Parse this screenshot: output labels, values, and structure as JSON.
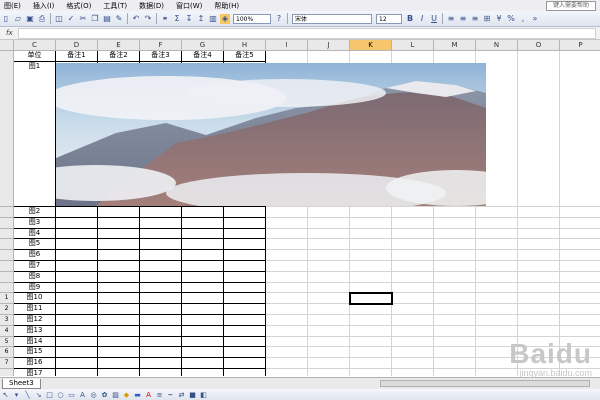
{
  "menubar": {
    "items": [
      "图(E)",
      "插入(I)",
      "格式(O)",
      "工具(T)",
      "数据(D)",
      "窗口(W)",
      "帮助(H)"
    ],
    "help_box": "键入需要帮助"
  },
  "toolbar": {
    "zoom": "100%",
    "font_name": "宋体",
    "font_size": "12"
  },
  "formula_bar": {
    "fx": "fx",
    "value": ""
  },
  "columns": [
    {
      "label": "C",
      "selected": false
    },
    {
      "label": "D",
      "selected": false
    },
    {
      "label": "E",
      "selected": false
    },
    {
      "label": "F",
      "selected": false
    },
    {
      "label": "G",
      "selected": false
    },
    {
      "label": "H",
      "selected": false
    },
    {
      "label": "I",
      "selected": false
    },
    {
      "label": "J",
      "selected": false
    },
    {
      "label": "K",
      "selected": true
    },
    {
      "label": "L",
      "selected": false
    },
    {
      "label": "M",
      "selected": false
    },
    {
      "label": "N",
      "selected": false
    },
    {
      "label": "O",
      "selected": false
    },
    {
      "label": "P",
      "selected": false
    }
  ],
  "header_row": [
    "单位",
    "备注1",
    "备注2",
    "备注3",
    "备注4",
    "备注5"
  ],
  "first_unit": "图1",
  "units": [
    "图2",
    "图3",
    "图4",
    "图5",
    "图6",
    "图7",
    "图8",
    "图9",
    "图10",
    "图11",
    "图12",
    "图13",
    "图14",
    "图15",
    "图16",
    "图17"
  ],
  "row_numbers": [
    "",
    "",
    "",
    "",
    "",
    "",
    "",
    "",
    "1",
    "2",
    "3",
    "4",
    "5",
    "6",
    "7"
  ],
  "sheet_tab": "Sheet3",
  "watermark": {
    "brand": "Baidu",
    "sub": "jingyan.baidu.com"
  }
}
